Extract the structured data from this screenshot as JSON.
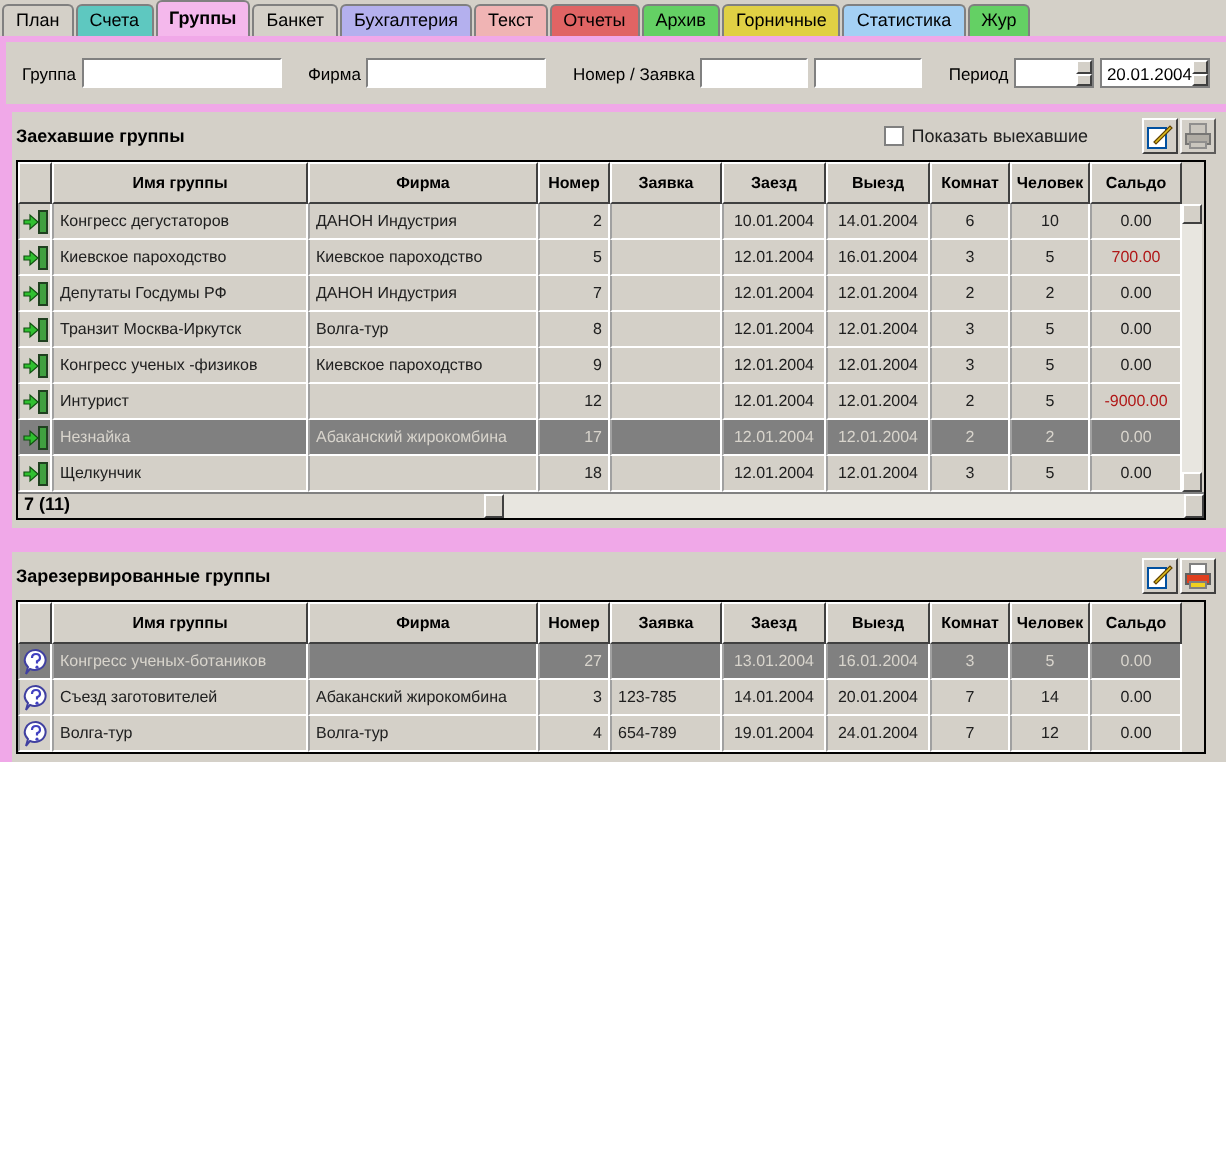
{
  "tabs": [
    {
      "label": "План",
      "selected": false,
      "color": "#d4d0c8"
    },
    {
      "label": "Счета",
      "selected": false,
      "color": "#5ec8c0"
    },
    {
      "label": "Группы",
      "selected": true,
      "color": "#f4b8ec"
    },
    {
      "label": "Банкет",
      "selected": false,
      "color": "#d4d0c8"
    },
    {
      "label": "Бухгалтерия",
      "selected": false,
      "color": "#b4b0ee"
    },
    {
      "label": "Текст",
      "selected": false,
      "color": "#f0b4b4"
    },
    {
      "label": "Отчеты",
      "selected": false,
      "color": "#e06464"
    },
    {
      "label": "Архив",
      "selected": false,
      "color": "#64d064"
    },
    {
      "label": "Горничные",
      "selected": false,
      "color": "#e0d044"
    },
    {
      "label": "Статистика",
      "selected": false,
      "color": "#a4d0f4"
    },
    {
      "label": "Жур",
      "selected": false,
      "color": "#64d064"
    }
  ],
  "filters": {
    "group_label": "Группа",
    "firm_label": "Фирма",
    "number_label": "Номер / Заявка",
    "period_label": "Период",
    "period_to": "20.01.2004"
  },
  "tables": [
    {
      "title": "Заехавшие группы",
      "kind": "checked_in",
      "show_departed": {
        "label": "Показать выехавшие",
        "checked": false
      },
      "print_disabled": true,
      "columns": [
        "Имя группы",
        "Фирма",
        "Номер",
        "Заявка",
        "Заезд",
        "Выезд",
        "Комнат",
        "Человек",
        "Сальдо"
      ],
      "rows": [
        {
          "cells": [
            "Конгресс дегустаторов",
            "ДАНОН Индустрия",
            "2",
            "",
            "10.01.2004",
            "14.01.2004",
            "6",
            "10",
            "0.00"
          ],
          "selected": false,
          "debt": false
        },
        {
          "cells": [
            "Киевское пароходство",
            "Киевское пароходство",
            "5",
            "",
            "12.01.2004",
            "16.01.2004",
            "3",
            "5",
            "700.00"
          ],
          "selected": false,
          "debt": true
        },
        {
          "cells": [
            "Депутаты Госдумы РФ",
            "ДАНОН Индустрия",
            "7",
            "",
            "12.01.2004",
            "12.01.2004",
            "2",
            "2",
            "0.00"
          ],
          "selected": false,
          "debt": false
        },
        {
          "cells": [
            "Транзит Москва-Иркутск",
            "Волга-тур",
            "8",
            "",
            "12.01.2004",
            "12.01.2004",
            "3",
            "5",
            "0.00"
          ],
          "selected": false,
          "debt": false
        },
        {
          "cells": [
            "Конгресс ученых -физиков",
            "Киевское пароходство",
            "9",
            "",
            "12.01.2004",
            "12.01.2004",
            "3",
            "5",
            "0.00"
          ],
          "selected": false,
          "debt": false
        },
        {
          "cells": [
            "Интурист",
            "",
            "12",
            "",
            "12.01.2004",
            "12.01.2004",
            "2",
            "5",
            "-9000.00"
          ],
          "selected": false,
          "debt": true
        },
        {
          "cells": [
            "Незнайка",
            "Абаканский жирокомбина",
            "17",
            "",
            "12.01.2004",
            "12.01.2004",
            "2",
            "2",
            "0.00"
          ],
          "selected": true,
          "debt": false
        },
        {
          "cells": [
            "Щелкунчик",
            "",
            "18",
            "",
            "12.01.2004",
            "12.01.2004",
            "3",
            "5",
            "0.00"
          ],
          "selected": false,
          "debt": false
        }
      ],
      "footer": "7 (11)"
    },
    {
      "title": "Зарезервированные группы",
      "kind": "reserved",
      "print_disabled": false,
      "columns": [
        "Имя группы",
        "Фирма",
        "Номер",
        "Заявка",
        "Заезд",
        "Выезд",
        "Комнат",
        "Человек",
        "Сальдо"
      ],
      "rows": [
        {
          "cells": [
            "Конгресс ученых-ботаников",
            "",
            "27",
            "",
            "13.01.2004",
            "16.01.2004",
            "3",
            "5",
            "0.00"
          ],
          "selected": true,
          "debt": false
        },
        {
          "cells": [
            "Съезд заготовителей",
            "Абаканский жирокомбина",
            "3",
            "123-785",
            "14.01.2004",
            "20.01.2004",
            "7",
            "14",
            "0.00"
          ],
          "selected": false,
          "debt": false
        },
        {
          "cells": [
            "Волга-тур",
            "Волга-тур",
            "4",
            "654-789",
            "19.01.2004",
            "24.01.2004",
            "7",
            "12",
            "0.00"
          ],
          "selected": false,
          "debt": false
        }
      ]
    }
  ]
}
